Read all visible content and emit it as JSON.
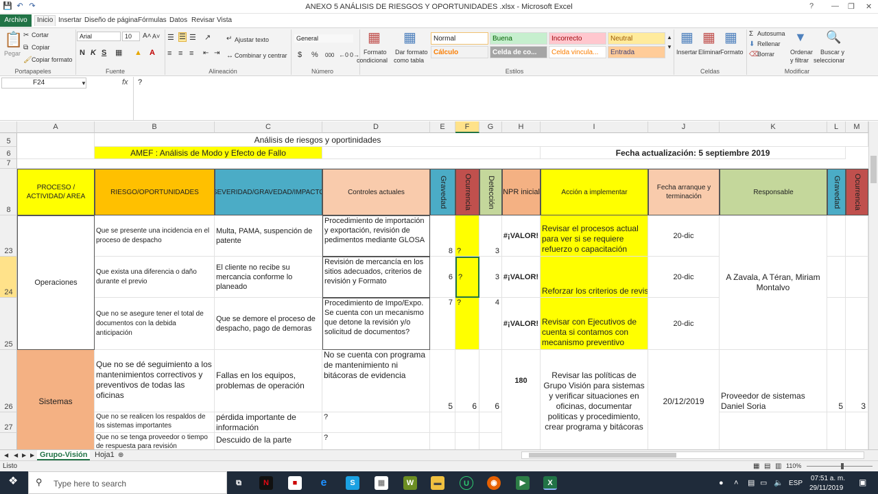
{
  "window": {
    "title": "ANEXO 5 ANÁLISIS DE RIESGOS Y OPORTUNIDADES .xlsx - Microsoft Excel"
  },
  "tabs": [
    "Archivo",
    "Inicio",
    "Insertar",
    "Diseño de página",
    "Fórmulas",
    "Datos",
    "Revisar",
    "Vista"
  ],
  "ribbon": {
    "paste": "Pegar",
    "cut": "Cortar",
    "copy": "Copiar",
    "copy_format": "Copiar formato",
    "clipboard": "Portapapeles",
    "font_name": "Arial",
    "font_size": "10",
    "bold": "N",
    "italic": "K",
    "underline": "S",
    "font_group": "Fuente",
    "wrap": "Ajustar texto",
    "merge": "Combinar y centrar",
    "align_group": "Alineación",
    "number_format": "General",
    "currency": "$",
    "percent": "%",
    "thousands": "000",
    "number_group": "Número",
    "cond_format_1": "Formato",
    "cond_format_2": "condicional",
    "table_format_1": "Dar formato",
    "table_format_2": "como tabla",
    "styles_group": "Estilos",
    "styles": [
      "Normal",
      "Buena",
      "Incorrecto",
      "Neutral",
      "Cálculo",
      "Celda de co...",
      "Celda vincula...",
      "Entrada"
    ],
    "insert": "Insertar",
    "delete": "Eliminar",
    "format": "Formato",
    "cells_group": "Celdas",
    "autosum": "Autosuma",
    "fill": "Rellenar",
    "clear": "Borrar",
    "sort_1": "Ordenar",
    "sort_2": "y filtrar",
    "find_1": "Buscar y",
    "find_2": "seleccionar",
    "modify_group": "Modificar"
  },
  "formula": {
    "namebox": "F24",
    "fx": "fx",
    "content": "?"
  },
  "columns": [
    "A",
    "B",
    "C",
    "D",
    "E",
    "F",
    "G",
    "H",
    "I",
    "J",
    "K",
    "L",
    "M"
  ],
  "rows": {
    "r5": "5",
    "r6": "6",
    "r7": "7",
    "r8": "8",
    "r23": "23",
    "r24": "24",
    "r25": "25",
    "r26": "26",
    "r27": "27"
  },
  "sheet": {
    "title": "Análisis de riesgos y oportinidades",
    "amef": "AMEF : Análisis de Modo y Efecto de Fallo",
    "fecha": "Fecha actualización: 5 septiembre 2019",
    "headers": {
      "a": "PROCESO / ACTIVIDAD/ AREA",
      "b": "RIESGO/OPORTUNIDADES",
      "c": "SEVERIDAD/GRAVEDAD/IMPACTO",
      "d": "Controles actuales",
      "e": "Gravedad",
      "f": "Ocurrencia",
      "g": "Detección",
      "h": "NPR inicial",
      "i": "Acción a implementar",
      "j": "Fecha arranque y terminación",
      "k": "Responsable",
      "l": "Gravedad",
      "m": "Ocurrencia"
    },
    "ops": "Operaciones",
    "sys": "Sistemas",
    "r23": {
      "b": "Que se presente una incidencia en el proceso de despacho",
      "c": "Multa, PAMA, suspención de patente",
      "d": "Procedimiento de importación y exportación, revisión de pedimentos mediante GLOSA",
      "e": "8",
      "f": "?",
      "g": "3",
      "h": "#¡VALOR!",
      "i": "Revisar el procesos actual para ver si se requiere refuerzo o capacitación",
      "j": "20-dic"
    },
    "r24": {
      "b": "Que exista una diferencia o daño durante el previo",
      "c": "El cliente no recibe su mercancia conforme lo planeado",
      "d": "Revisión de mercancía en los sitios adecuados, criterios de revisión y Formato",
      "e": "6",
      "f": "?",
      "g": "3",
      "h": "#¡VALOR!",
      "i": "Reforzar los criterios de revis",
      "j": "20-dic",
      "k": "A Zavala, A Téran, Miriam Montalvo"
    },
    "r25": {
      "b": "Que no se asegure tener el total de documentos con la debida anticipación",
      "c": "Que se demore el proceso de despacho, pago de demoras",
      "d": "Procedimiento de Impo/Expo. Se cuenta con un mecanismo que detone la revisión y/o solicitud de documentos?",
      "e": "7",
      "f": "?",
      "g": "4",
      "h": "#¡VALOR!",
      "i": "Revisar con Ejecutivos de cuenta si contamos con mecanismo preventivo",
      "j": "20-dic"
    },
    "r26": {
      "b": "Que no se dé seguimiento a los mantenimientos correctivos y preventivos de todas las oficinas",
      "c": "Fallas en los equipos, problemas de operación",
      "d": "No se cuenta con programa de mantenimiento ni bitácoras de evidencia",
      "e": "5",
      "f": "6",
      "g": "6",
      "h": "180",
      "i": "Revisar las políticas de Grupo Visión para sistemas y verificar situaciones en oficinas, documentar politicas y procedimiento, crear programa y bitácoras",
      "j": "20/12/2019",
      "k": "Proveedor de sistemas Daniel Soria",
      "l": "5",
      "m": "3"
    },
    "r27": {
      "b": "Que no se realicen los respaldos de los sistemas importantes",
      "c": "pérdida importante de información",
      "d": "?"
    },
    "r28": {
      "b": "Que no se tenga proveedor o tiempo de respuesta para revisión",
      "c": "Descuido de la parte",
      "d": "?"
    }
  },
  "sheets": [
    "Grupo-Visión",
    "Hoja1"
  ],
  "status": {
    "ready": "Listo",
    "zoom": "110%"
  },
  "taskbar": {
    "search": "Type here to search",
    "lang": "ESP",
    "time": "07:51 a. m.",
    "date": "29/11/2019"
  },
  "colors": {
    "yellow": "#ffff00",
    "orange": "#ffc000",
    "teal": "#4bacc6",
    "peach": "#f9cbac",
    "red": "#c0504d",
    "green": "#c4d79b",
    "salmon": "#f4b183",
    "excel": "#217346"
  }
}
